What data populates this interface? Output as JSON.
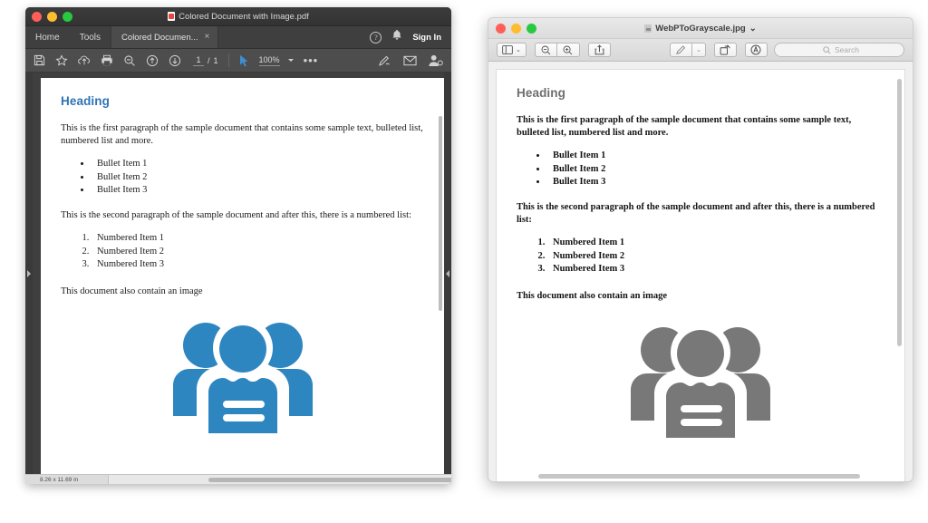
{
  "acrobat_window": {
    "title": "Colored Document with Image.pdf",
    "title_icon": "pdf-file-icon",
    "traffic_lights": {
      "close": "#ff5f57",
      "minimize": "#febc2e",
      "maximize": "#28c840"
    },
    "menu": [
      {
        "label": "Home",
        "name": "home"
      },
      {
        "label": "Tools",
        "name": "tools"
      }
    ],
    "tab": {
      "label": "Colored Documen...",
      "close": "×"
    },
    "right_controls": {
      "help": "?",
      "bell_icon": "bell-icon",
      "sign_in": "Sign In"
    },
    "toolbar": {
      "icons": [
        "save-icon",
        "star-icon",
        "upload-cloud-icon",
        "print-icon",
        "zoom-out-icon",
        "previous-page-icon",
        "next-page-icon"
      ],
      "page_current": "1",
      "page_separator": "/",
      "page_total": "1",
      "select_tool_icon": "cursor-arrow-icon",
      "zoom_level": "100%",
      "more_tools": "•••",
      "right_icons": [
        "highlight-pen-icon",
        "email-icon",
        "share-person-icon"
      ]
    },
    "status": {
      "dimensions": "8.26 x 11.69 in"
    },
    "left_rail_icon": "expand-left-panel-icon",
    "right_rail_icon": "collapse-right-panel-icon"
  },
  "preview_window": {
    "title": "WebPToGrayscale.jpg",
    "title_chevron": "⌄",
    "title_icon": "jpg-file-icon",
    "traffic_lights": {
      "close": "#ff5f57",
      "minimize": "#febc2e",
      "maximize": "#28c840"
    },
    "toolbar": {
      "sidebar_toggle_icon": "sidebar-toggle-icon",
      "sidebar_chevron": "⌄",
      "zoom_out_icon": "zoom-out-icon",
      "zoom_in_icon": "zoom-in-icon",
      "share_icon": "share-icon",
      "markup_icon": "markup-pen-icon",
      "markup_chevron": "⌄",
      "rotate_icon": "rotate-icon",
      "annotate_icon": "annotate-icon",
      "search_icon": "search-icon",
      "search_placeholder": "Search"
    }
  },
  "document": {
    "heading": "Heading",
    "paragraph_1": "This is the first paragraph of the sample document that contains some sample text, bulleted list, numbered list and more.",
    "bullets": [
      "Bullet Item 1",
      "Bullet Item 2",
      "Bullet Item 3"
    ],
    "paragraph_2": "This is the second paragraph of the sample document and after this, there is a numbered list:",
    "numbered": [
      "Numbered Item 1",
      "Numbered Item 2",
      "Numbered Item 3"
    ],
    "paragraph_3": "This document also contain an image",
    "image": {
      "name": "people-group-icon",
      "color_variant_hex": "#2e86c1",
      "grayscale_variant_hex": "#787878"
    }
  }
}
